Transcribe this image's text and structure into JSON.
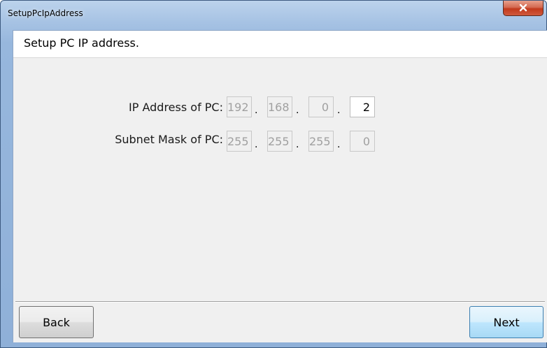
{
  "window": {
    "title": "SetupPcIpAddress",
    "close_icon": "close-icon",
    "colors": {
      "close": "#c2391c",
      "frame": "#a7c3e4",
      "client": "#f0f0f0"
    }
  },
  "header": {
    "text": "Setup PC IP address."
  },
  "form": {
    "ip": {
      "label": "IP Address of PC:",
      "octets": [
        "192",
        "168",
        "0",
        "2"
      ],
      "separator": "."
    },
    "mask": {
      "label": "Subnet Mask of PC:",
      "octets": [
        "255",
        "255",
        "255",
        "0"
      ],
      "separator": "."
    }
  },
  "footer": {
    "back_label": "Back",
    "next_label": "Next"
  }
}
